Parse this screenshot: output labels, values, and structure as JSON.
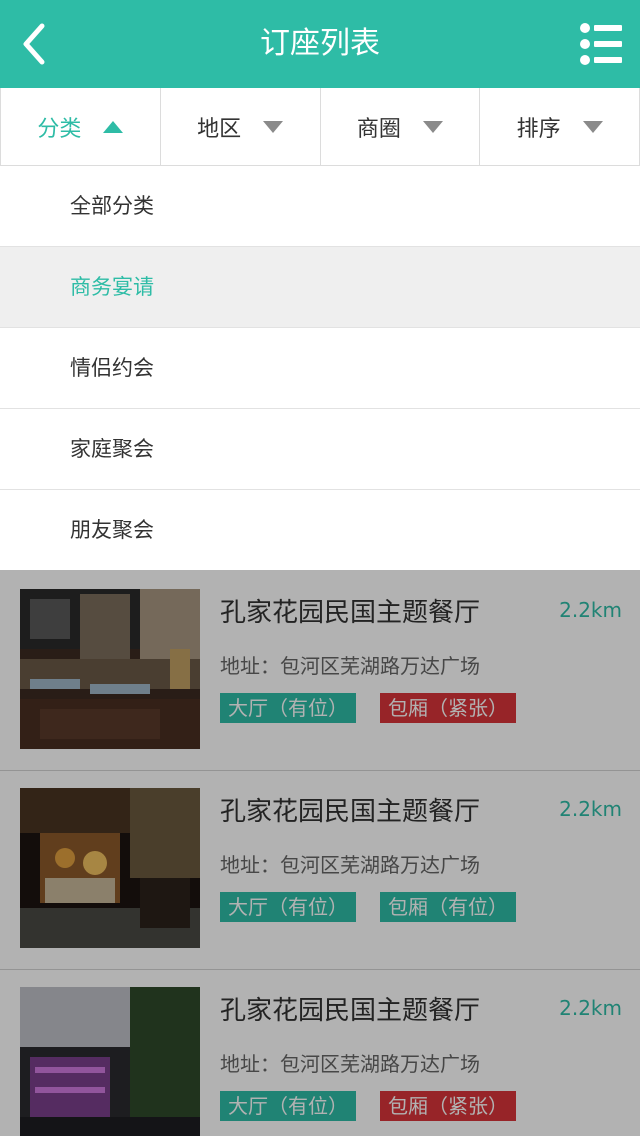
{
  "header": {
    "title": "订座列表",
    "back_icon": "chevron-left-icon",
    "menu_icon": "list-menu-icon",
    "bg_color": "#2ebca6"
  },
  "filters": [
    {
      "label": "分类",
      "active": true
    },
    {
      "label": "地区",
      "active": false
    },
    {
      "label": "商圈",
      "active": false
    },
    {
      "label": "排序",
      "active": false
    }
  ],
  "dropdown": {
    "options": [
      "全部分类",
      "商务宴请",
      "情侣约会",
      "家庭聚会",
      "朋友聚会"
    ],
    "selected": "商务宴请"
  },
  "restaurants": [
    {
      "name": "孔家花园民国主题餐厅",
      "distance": "2.2km",
      "address": "地址：包河区芜湖路万达广场",
      "hall": "大厅（有位）",
      "hall_color": "#2ebca6",
      "room": "包厢（紧张）",
      "room_color": "#d9343a"
    },
    {
      "name": "孔家花园民国主题餐厅",
      "distance": "2.2km",
      "address": "地址：包河区芜湖路万达广场",
      "hall": "大厅（有位）",
      "hall_color": "#2ebca6",
      "room": "包厢（有位）",
      "room_color": "#2ebca6"
    },
    {
      "name": "孔家花园民国主题餐厅",
      "distance": "2.2km",
      "address": "地址：包河区芜湖路万达广场",
      "hall": "大厅（有位）",
      "hall_color": "#2ebca6",
      "room": "包厢（紧张）",
      "room_color": "#d9343a"
    }
  ],
  "colors": {
    "accent": "#2ebca6",
    "busy": "#d9343a"
  }
}
